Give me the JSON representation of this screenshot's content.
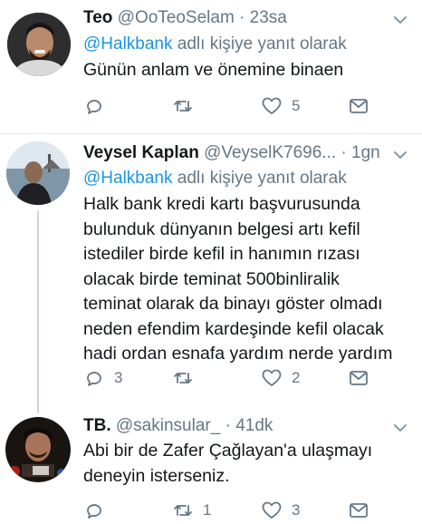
{
  "colors": {
    "link": "#1b95e0",
    "muted": "#657786",
    "text": "#14171a",
    "divider": "#e1e8ed"
  },
  "tweets": [
    {
      "name": "Teo",
      "handle": "@OoTeoSelam",
      "dot": "·",
      "time": "23sa",
      "reply_mention": "@Halkbank",
      "reply_suffix": " adlı kişiye yanıt olarak",
      "lines": [
        "Günün anlam ve önemine binaen"
      ],
      "replies": "",
      "retweets": "",
      "likes": "5"
    },
    {
      "name": "Veysel Kaplan",
      "handle": "@VeyselK7696...",
      "dot": "·",
      "time": "1gn",
      "reply_mention": "@Halkbank",
      "reply_suffix": " adlı kişiye yanıt olarak",
      "lines": [
        "Halk bank kredi kartı başvurusunda",
        "bulunduk dünyanın belgesi artı kefil",
        "istediler birde kefil in hanımın rızası",
        "olacak birde teminat 500binliralik",
        "teminat olarak da binayı göster  olmadı",
        "neden efendim kardeşinde kefil olacak",
        "hadi ordan esnafa yardım nerde yardım"
      ],
      "replies": "3",
      "retweets": "",
      "likes": "2"
    },
    {
      "name": "TB.",
      "handle": "@sakinsular_",
      "dot": "·",
      "time": "41dk",
      "lines": [
        "Abi bir de Zafer Çağlayan'a ulaşmayı",
        "deneyin isterseniz."
      ],
      "replies": "",
      "retweets": "1",
      "likes": "3"
    }
  ]
}
